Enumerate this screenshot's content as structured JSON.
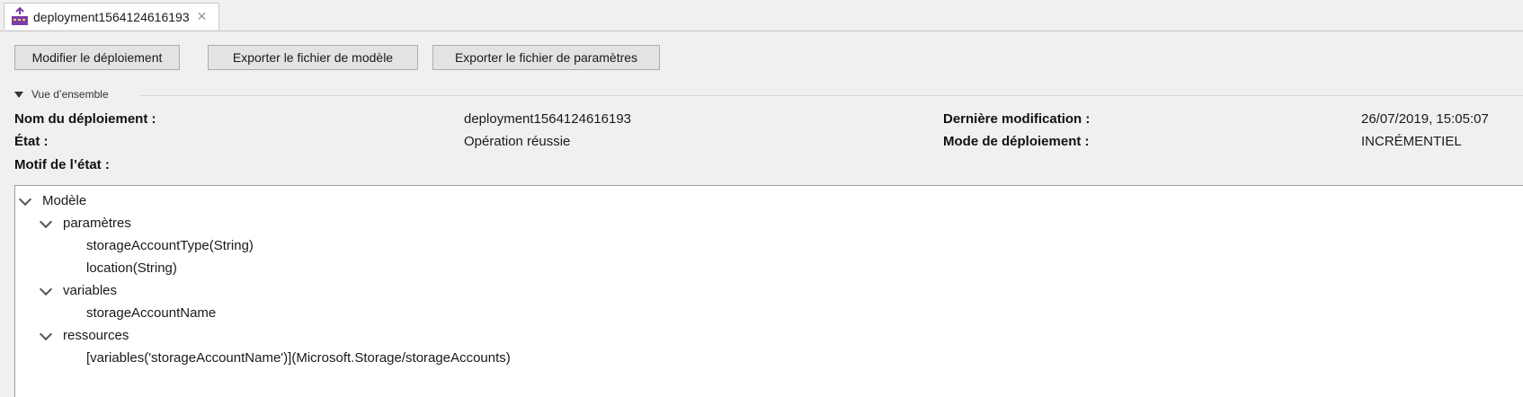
{
  "tab": {
    "title": "deployment1564124616193",
    "close_icon": "close-icon"
  },
  "toolbar": {
    "edit_label": "Modifier le déploiement",
    "export_template_label": "Exporter le fichier de modèle",
    "export_params_label": "Exporter le fichier de paramètres"
  },
  "overview": {
    "section_title": "Vue d’ensemble",
    "name_label": "Nom du déploiement :",
    "name_value": "deployment1564124616193",
    "modified_label": "Dernière modification :",
    "modified_value": "26/07/2019, 15:05:07",
    "state_label": "État :",
    "state_value": "Opération réussie",
    "mode_label": "Mode de déploiement :",
    "mode_value": "INCRÉMENTIEL",
    "reason_label": "Motif de l’état :"
  },
  "tree": {
    "root": "Modèle",
    "parameters": "paramètres",
    "param_items": [
      "storageAccountType(String)",
      "location(String)"
    ],
    "variables": "variables",
    "variable_items": [
      "storageAccountName"
    ],
    "resources": "ressources",
    "resource_items": [
      "[variables('storageAccountName')](Microsoft.Storage/storageAccounts)"
    ]
  },
  "colors": {
    "background": "#f0f0f0",
    "panel": "#ffffff",
    "button": "#e3e3e3",
    "icon_purple": "#7b3fa6"
  }
}
